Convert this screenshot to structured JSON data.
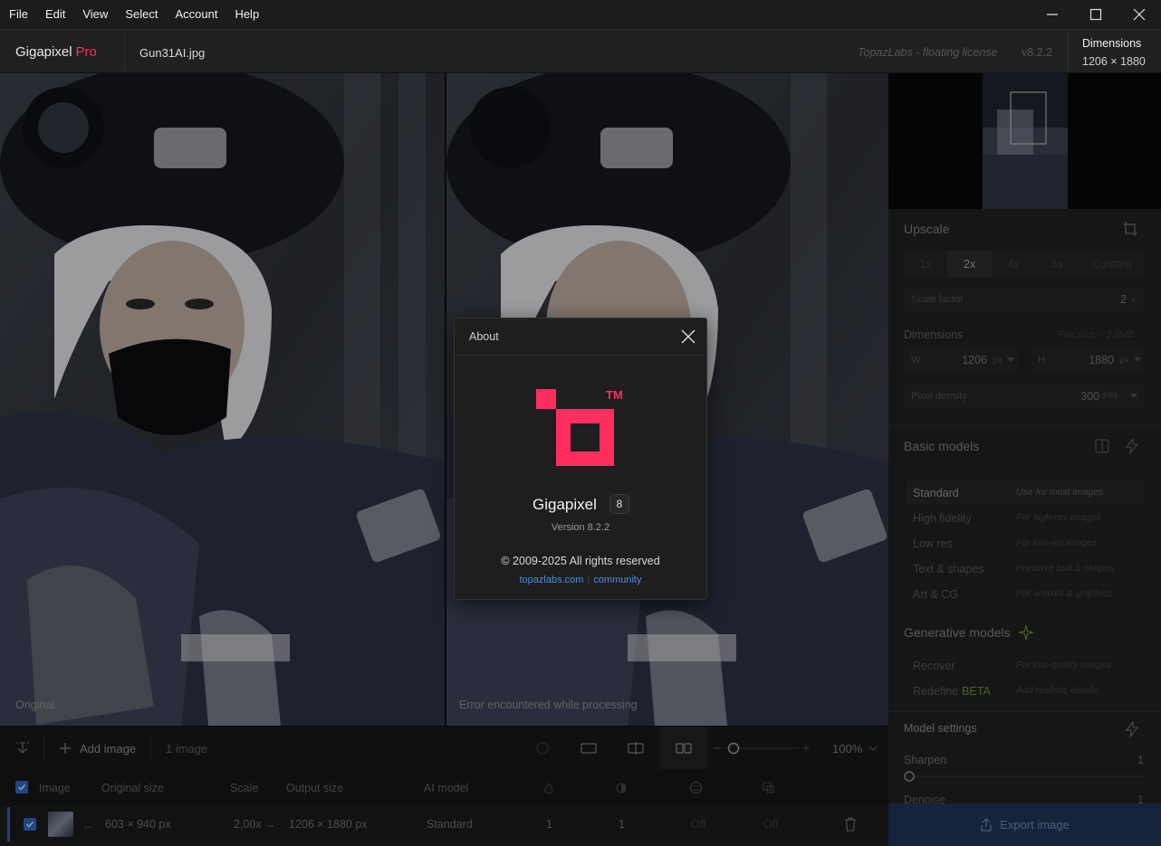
{
  "menu": [
    "File",
    "Edit",
    "View",
    "Select",
    "Account",
    "Help"
  ],
  "window_controls": {
    "minimize_icon": "minimize-icon",
    "maximize_icon": "maximize-icon",
    "close_icon": "close-icon"
  },
  "header": {
    "app_name": "Gigapixel",
    "app_tier": "Pro",
    "filename": "Gun31AI.jpg",
    "license": "TopazLabs - floating license",
    "version": "v8.2.2",
    "dimensions_label": "Dimensions",
    "dimensions_value": "1206 × 1880"
  },
  "panes": {
    "left_caption": "Original",
    "right_caption": "Error encountered while processing"
  },
  "toolbar": {
    "add_image": "Add image",
    "image_count": "1 image",
    "zoom": "100%"
  },
  "table": {
    "headers": [
      "Image",
      "Original size",
      "Scale",
      "Output size",
      "AI model"
    ],
    "row": {
      "ellipsis": "...",
      "original_size": "603 × 940 px",
      "scale": "2,00x →",
      "output_size": "1206 × 1880 px",
      "model": "Standard",
      "col1": "1",
      "col2": "1",
      "col3": "Off",
      "col4": "Off"
    }
  },
  "right_panel": {
    "upscale_title": "Upscale",
    "scale_options": [
      "1x",
      "2x",
      "4x",
      "6x",
      "Custom"
    ],
    "selected_scale": "2x",
    "scale_factor_label": "Scale factor",
    "scale_factor_value": "2",
    "scale_factor_unit": "x",
    "dimensions_title": "Dimensions",
    "file_size": "File size: ~3.6MB",
    "w_label": "W",
    "w_value": "1206",
    "h_label": "H",
    "h_value": "1880",
    "px_unit": "px",
    "pixel_density_label": "Pixel density",
    "pixel_density_value": "300",
    "ppi_unit": "PPI",
    "basic_models_title": "Basic models",
    "basic_models": [
      {
        "name": "Standard",
        "desc": "Use for most images"
      },
      {
        "name": "High fidelity",
        "desc": "For high-res images"
      },
      {
        "name": "Low res",
        "desc": "For low-res images"
      },
      {
        "name": "Text & shapes",
        "desc": "Preserve text & shapes"
      },
      {
        "name": "Art & CG",
        "desc": "For artwork & graphics"
      }
    ],
    "generative_models_title": "Generative models",
    "generative_models": [
      {
        "name": "Recover",
        "desc": "For low-quality images"
      },
      {
        "name": "Redefine",
        "desc": "Add realistic details",
        "badge": "BETA"
      }
    ],
    "model_settings_title": "Model settings",
    "sharpen_label": "Sharpen",
    "sharpen_value": "1",
    "denoise_label": "Denoise",
    "denoise_value": "1",
    "export_label": "Export image"
  },
  "about_dialog": {
    "title": "About",
    "app_name": "Gigapixel",
    "major_version": "8",
    "version": "Version 8.2.2",
    "copyright": "© 2009-2025 All rights reserved",
    "link1": "topazlabs.com",
    "link2": "community",
    "trademark": "TM"
  },
  "colors": {
    "brand_pink": "#ff2e5f",
    "accent_blue": "#2b63b8",
    "link_blue": "#4b8fe8"
  }
}
